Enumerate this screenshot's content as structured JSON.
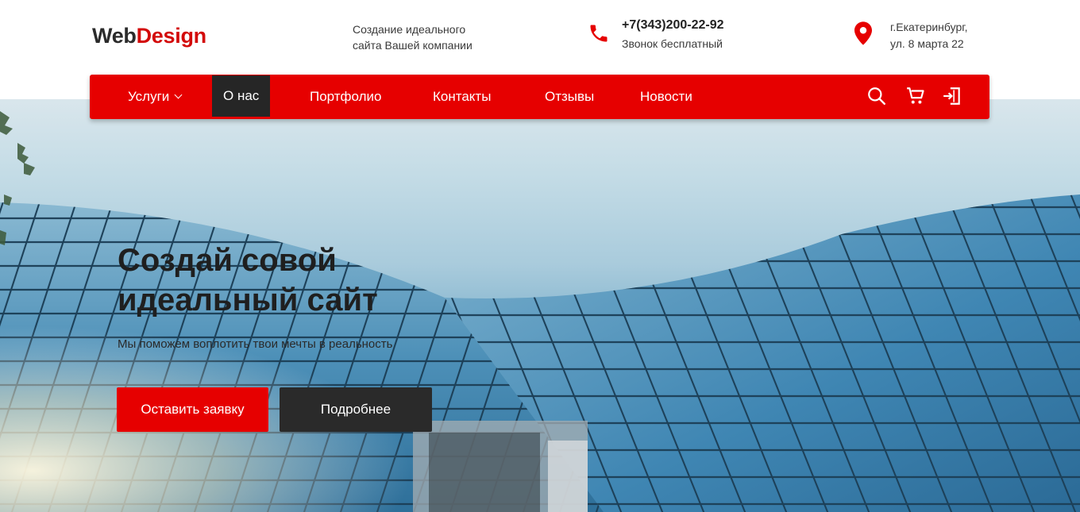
{
  "header": {
    "logo_part1": "Web",
    "logo_part2": "Design",
    "tagline_line1": "Создание идеального",
    "tagline_line2": "сайта Вашей компании",
    "phone": "+7(343)200-22-92",
    "phone_note": "Звонок бесплатный",
    "address_line1": "г.Екатеринбург,",
    "address_line2": "ул. 8 марта 22"
  },
  "nav": {
    "items": [
      {
        "label": "Услуги",
        "has_dropdown": true
      },
      {
        "label": "О нас",
        "active": true
      },
      {
        "label": "Портфолио"
      },
      {
        "label": "Контакты"
      },
      {
        "label": "Отзывы"
      },
      {
        "label": "Новости"
      }
    ],
    "icons": [
      "search-icon",
      "cart-icon",
      "login-icon"
    ]
  },
  "hero": {
    "title_line1": "Создай совой",
    "title_line2": "идеальный сайт",
    "subtitle": "Мы поможем воплотить твои мечты в реальность",
    "primary_button": "Оставить заявку",
    "secondary_button": "Подробнее"
  },
  "colors": {
    "accent": "#e60000",
    "dark": "#262626",
    "logo_red": "#d30a0a"
  }
}
